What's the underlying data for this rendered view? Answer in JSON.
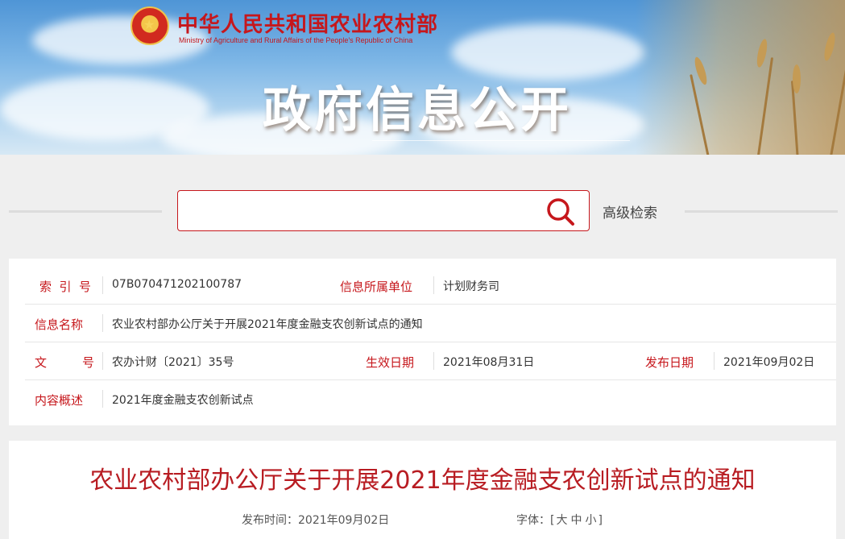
{
  "header": {
    "ministry_cn": "中华人民共和国农业农村部",
    "ministry_en": "Ministry of Agriculture and Rural Affairs of the People's Republic of China",
    "title": "政府信息公开",
    "emblem_glyph": "★"
  },
  "search": {
    "placeholder": "",
    "value": "",
    "advanced_label": "高级检索"
  },
  "info": {
    "index_label": "索引号",
    "index_value": "07B070471202100787",
    "unit_label": "信息所属单位",
    "unit_value": "计划财务司",
    "name_label": "信息名称",
    "name_value": "农业农村部办公厅关于开展2021年度金融支农创新试点的通知",
    "doc_label_1": "文",
    "doc_label_2": "号",
    "doc_value": "农办计财〔2021〕35号",
    "effective_label": "生效日期",
    "effective_value": "2021年08月31日",
    "publish_label": "发布日期",
    "publish_value": "2021年09月02日",
    "summary_label": "内容概述",
    "summary_value": "2021年度金融支农创新试点"
  },
  "article": {
    "title": "农业农村部办公厅关于开展2021年度金融支农创新试点的通知",
    "publish_time": "发布时间：2021年09月02日",
    "font_label": "字体：[",
    "font_large": "大",
    "font_medium": "中",
    "font_small": "小",
    "font_close": "]"
  },
  "colors": {
    "accent": "#c6171c",
    "title_red": "#b81c22",
    "page_bg": "#efefef"
  }
}
